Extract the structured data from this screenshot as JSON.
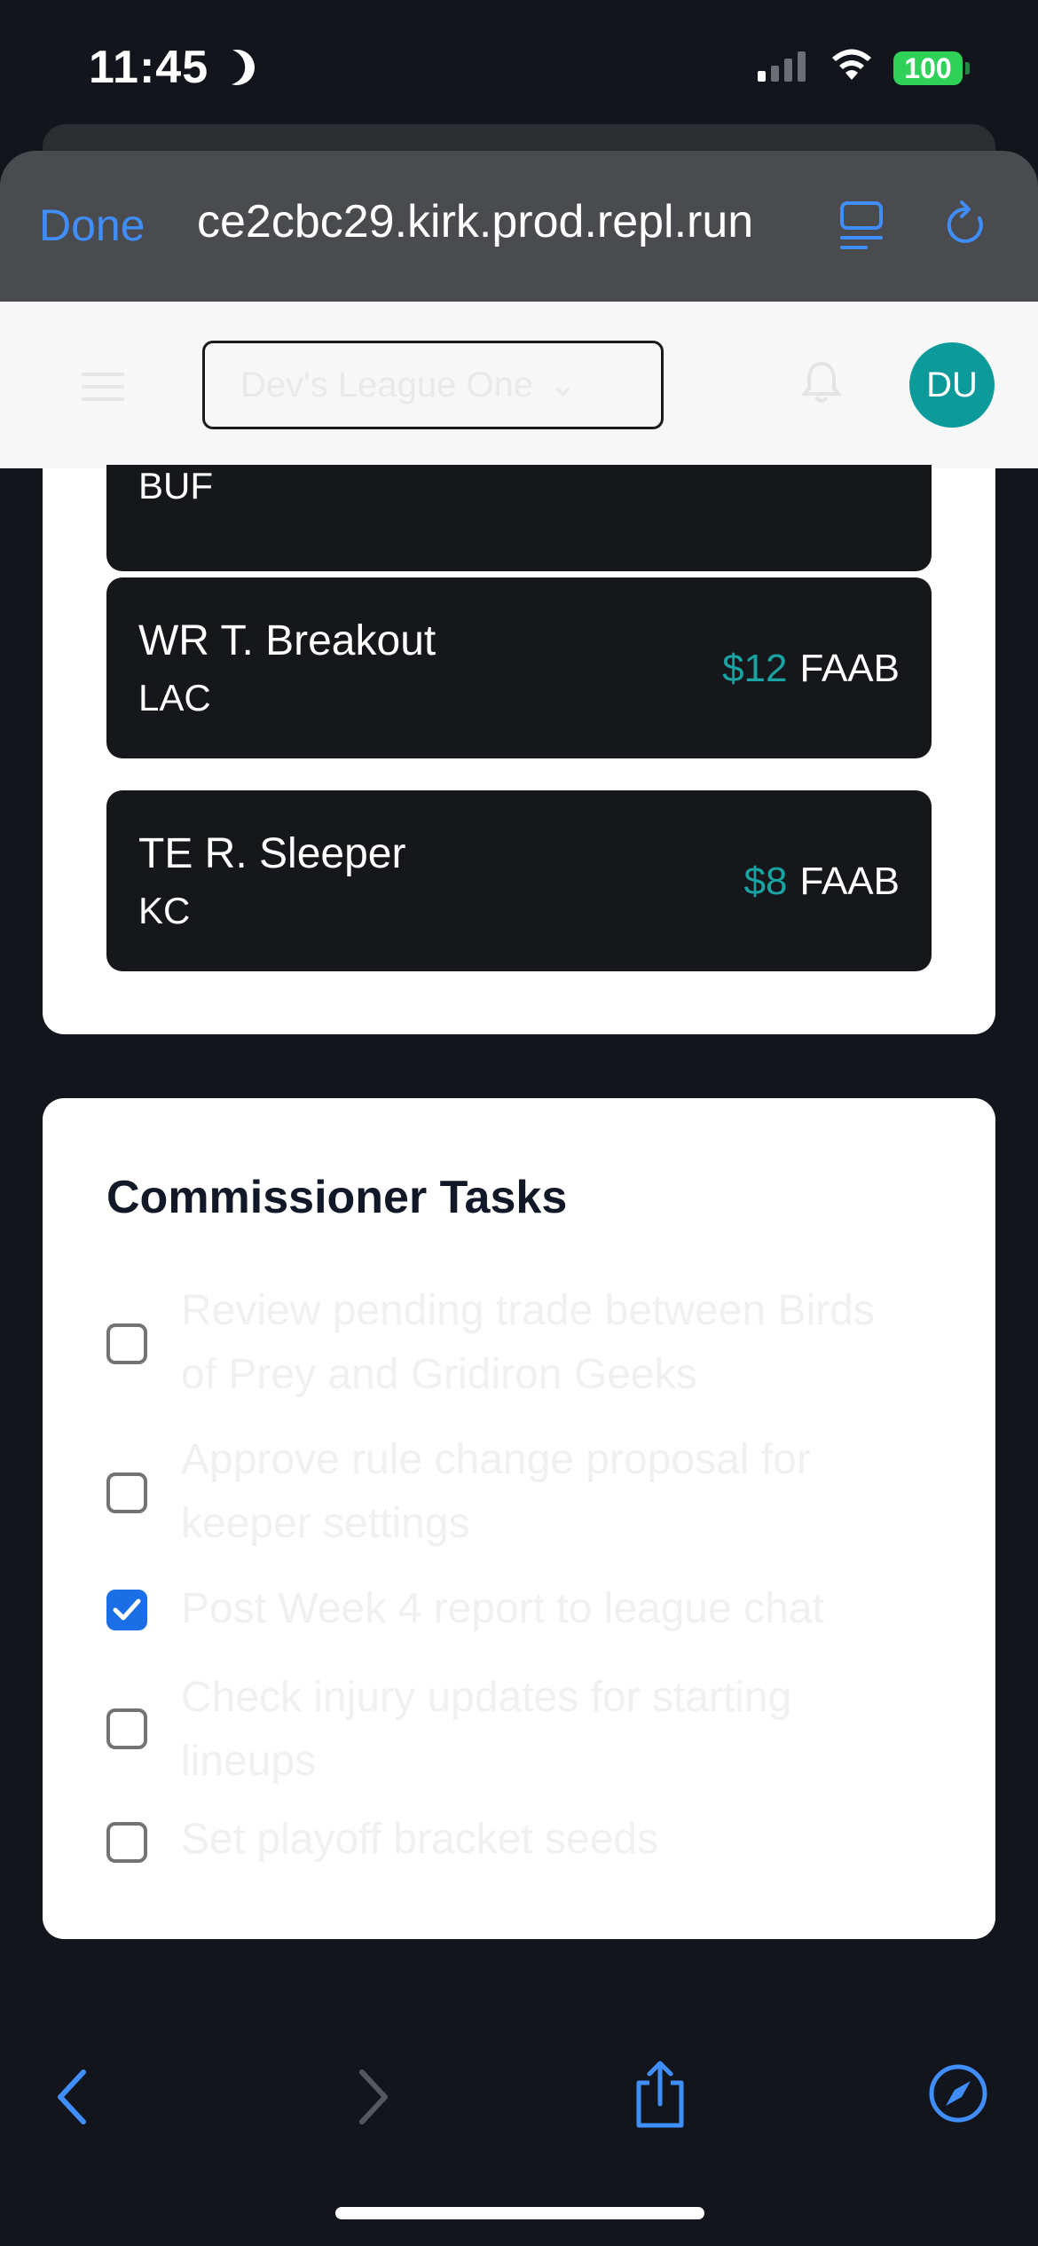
{
  "status_bar": {
    "time": "11:45",
    "battery": "100"
  },
  "browser": {
    "done_label": "Done",
    "url": "ce2cbc29.kirk.prod.repl.run"
  },
  "header": {
    "league_select": "Dev's League One",
    "avatar_initials": "DU"
  },
  "waiver_wire": {
    "partial_team": "BUF",
    "players": [
      {
        "name": "WR T. Breakout",
        "team": "LAC",
        "amount": "$12",
        "unit": "FAAB"
      },
      {
        "name": "TE R. Sleeper",
        "team": "KC",
        "amount": "$8",
        "unit": "FAAB"
      }
    ]
  },
  "commissioner": {
    "title": "Commissioner Tasks",
    "tasks": [
      {
        "text": "Review pending trade between Birds of Prey and Gridiron Geeks",
        "done": false
      },
      {
        "text": "Approve rule change proposal for keeper settings",
        "done": false
      },
      {
        "text": "Post Week 4 report to league chat",
        "done": true
      },
      {
        "text": "Check injury updates for starting lineups",
        "done": false
      },
      {
        "text": "Set playoff bracket seeds",
        "done": false
      }
    ]
  },
  "colors": {
    "accent_blue": "#3f8efc",
    "teal": "#0d9a9a",
    "card_dark": "#15171b",
    "check_blue": "#1a6fe6"
  },
  "icons": [
    "moon-icon",
    "signal-icon",
    "wifi-icon",
    "battery-icon",
    "reader-icon",
    "reload-icon",
    "menu-icon",
    "chevron-down-icon",
    "bell-icon",
    "back-icon",
    "forward-icon",
    "share-icon",
    "compass-icon"
  ]
}
